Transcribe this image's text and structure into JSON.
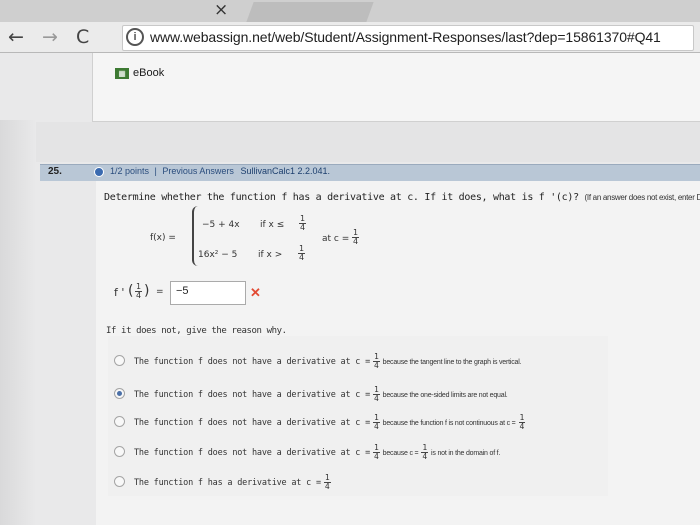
{
  "browser": {
    "url": "www.webassign.net/web/Student/Assignment-Responses/last?dep=15861370#Q41",
    "tab_close": "×"
  },
  "ebook": {
    "label": "eBook"
  },
  "question": {
    "number": "25.",
    "points": "1/2 points",
    "separator": "|",
    "previous_answers": "Previous Answers",
    "source": "SullivanCalc1 2.2.041.",
    "prompt": "Determine whether the function f has a derivative at c. If it does, what is f '(c)?",
    "prompt_note": "(If an answer does not exist, enter DNE.)",
    "function_label": "f(x) =",
    "piece1_expr": "−5 + 4x",
    "piece1_cond": "if  x ≤",
    "piece2_expr": "16x² − 5",
    "piece2_cond": "if  x >",
    "frac_num": "1",
    "frac_den": "4",
    "at_c": "at c =",
    "fprime_label": "f '",
    "equals": "=",
    "answer_value": "−5",
    "wrong_mark": "✕",
    "reason_heading": "If it does not, give the reason why.",
    "options": [
      {
        "text": "The function f does not have a derivative at c =",
        "tail": "because the tangent line to the graph is vertical.",
        "selected": false
      },
      {
        "text": "The function f does not have a derivative at c =",
        "tail": "because the one-sided limits are not equal.",
        "selected": true
      },
      {
        "text": "The function f does not have a derivative at c =",
        "tail": "because the function f is not continuous at c =",
        "selected": false
      },
      {
        "text": "The function f does not have a derivative at c =",
        "tail": "because c =",
        "tail2": "is not in the domain of f.",
        "selected": false
      },
      {
        "text": "The function f has a derivative at c =",
        "tail": "",
        "selected": false
      }
    ]
  }
}
